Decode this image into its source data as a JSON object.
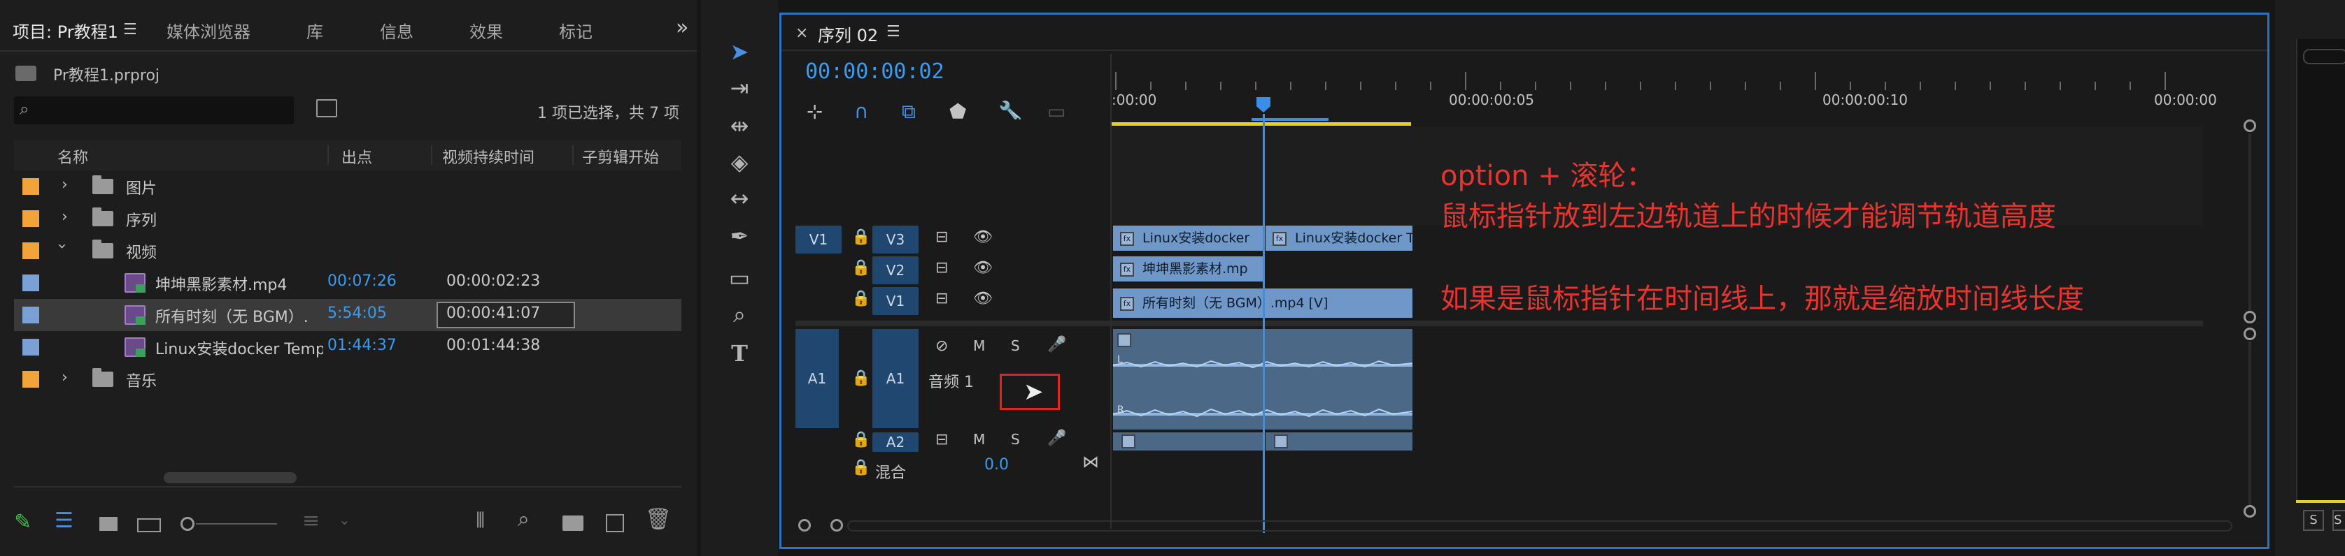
{
  "project_panel": {
    "tabs": [
      "项目: Pr教程1",
      "媒体浏览器",
      "库",
      "信息",
      "效果",
      "标记"
    ],
    "project_file": "Pr教程1.prproj",
    "selection_status": "1 项已选择，共 7 项",
    "columns": [
      "名称",
      "出点",
      "视频持续时间",
      "子剪辑开始"
    ],
    "rows": [
      {
        "name": "图片",
        "type": "folder",
        "expanded": false,
        "color": "#f1a43a",
        "out": "",
        "duration": ""
      },
      {
        "name": "序列",
        "type": "folder",
        "expanded": false,
        "color": "#f1a43a",
        "out": "",
        "duration": ""
      },
      {
        "name": "视频",
        "type": "folder",
        "expanded": true,
        "color": "#f1a43a",
        "out": "",
        "duration": ""
      },
      {
        "name": "坤坤黑影素材.mp4",
        "type": "clip",
        "color": "#7aa0d6",
        "out": "00:07:26",
        "duration": "00:00:02:23"
      },
      {
        "name": "所有时刻（无 BGM）.",
        "type": "clip",
        "color": "#7aa0d6",
        "out": "5:54:05",
        "duration": "00:00:41:07",
        "selected": true
      },
      {
        "name": "Linux安装docker Templ",
        "type": "clip",
        "color": "#7aa0d6",
        "out": "01:44:37",
        "duration": "00:01:44:38"
      },
      {
        "name": "音乐",
        "type": "folder",
        "expanded": false,
        "color": "#f1a43a",
        "out": "",
        "duration": ""
      }
    ]
  },
  "timeline": {
    "tab_title": "序列 02",
    "timecode": "00:00:00:02",
    "ruler_labels": [
      ":00:00",
      "00:00:00:05",
      "00:00:00:10",
      "00:00:00"
    ],
    "video_tracks": [
      {
        "source": "V1",
        "label": "V3",
        "clips": [
          {
            "name": "Linux安装docker"
          },
          {
            "name": "Linux安装docker T"
          }
        ]
      },
      {
        "source": "",
        "label": "V2",
        "clips": [
          {
            "name": "坤坤黑影素材.mp"
          }
        ]
      },
      {
        "source": "",
        "label": "V1",
        "clips": [
          {
            "name": "所有时刻（无 BGM）.mp4 [V]"
          }
        ]
      }
    ],
    "audio_tracks": [
      {
        "source": "A1",
        "label": "A1",
        "name": "音频 1",
        "m": "M",
        "s": "S"
      },
      {
        "source": "",
        "label": "A2",
        "name": "",
        "m": "M",
        "s": "S"
      }
    ],
    "mix": {
      "label": "混合",
      "value": "0.0"
    },
    "audio_channel_labels": [
      "L",
      "R"
    ]
  },
  "annotations": {
    "line1": "option + 滚轮：",
    "line2": "鼠标指针放到左边轨道上的时候才能调节轨道高度",
    "line3": "如果是鼠标指针在时间线上，那就是缩放时间线长度"
  },
  "right_panel": {
    "buttons": [
      "S",
      "S"
    ]
  },
  "colors": {
    "accent": "#2b73c6",
    "timecode": "#3a9bef",
    "playhead": "#3a8ee8",
    "annotation": "#e8332f"
  }
}
